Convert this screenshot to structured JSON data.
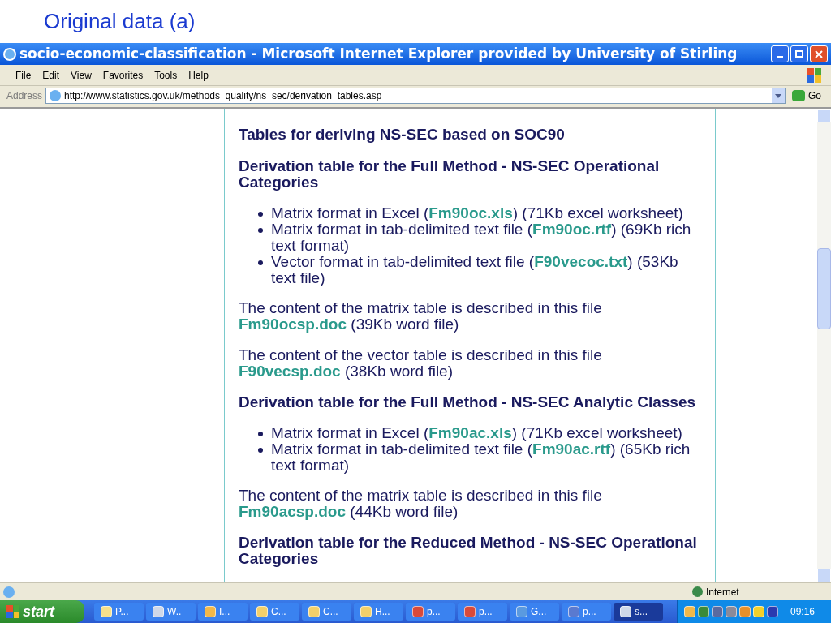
{
  "slide_title": "Original data (a)",
  "window": {
    "title": "socio-economic-classification - Microsoft Internet Explorer provided by University of Stirling"
  },
  "menu": [
    "File",
    "Edit",
    "View",
    "Favorites",
    "Tools",
    "Help"
  ],
  "address": {
    "label": "Address",
    "value": "http://www.statistics.gov.uk/methods_quality/ns_sec/derivation_tables.asp",
    "go": "Go"
  },
  "content": [
    {
      "kind": "title",
      "parts": [
        {
          "text": "Tables for deriving NS-SEC based on SOC90",
          "link": false
        }
      ]
    },
    {
      "kind": "heading",
      "parts": [
        {
          "text": "Derivation table for the Full Method - NS-SEC Operational Categories",
          "link": false
        }
      ]
    },
    {
      "kind": "list",
      "items": [
        [
          {
            "text": "Matrix format in Excel (",
            "link": false
          },
          {
            "text": "Fm90oc.xls",
            "link": true
          },
          {
            "text": ") (71Kb excel worksheet)",
            "link": false
          }
        ],
        [
          {
            "text": "Matrix format in tab-delimited text file (",
            "link": false
          },
          {
            "text": "Fm90oc.rtf",
            "link": true
          },
          {
            "text": ") (69Kb rich text format)",
            "link": false
          }
        ],
        [
          {
            "text": "Vector format in tab-delimited text file (",
            "link": false
          },
          {
            "text": "F90vecoc.txt",
            "link": true
          },
          {
            "text": ") (53Kb text file)",
            "link": false
          }
        ]
      ]
    },
    {
      "kind": "para",
      "parts": [
        {
          "text": "The content of the matrix table is described in this file ",
          "link": false
        },
        {
          "text": "Fm90ocsp.doc",
          "link": true
        },
        {
          "text": " (39Kb word file)",
          "link": false
        }
      ]
    },
    {
      "kind": "para",
      "parts": [
        {
          "text": "The content of the vector table is described in this file ",
          "link": false
        },
        {
          "text": "F90vecsp.doc",
          "link": true
        },
        {
          "text": " (38Kb word file)",
          "link": false
        }
      ]
    },
    {
      "kind": "heading",
      "parts": [
        {
          "text": "Derivation table for the Full Method - NS-SEC Analytic Classes",
          "link": false
        }
      ]
    },
    {
      "kind": "list",
      "items": [
        [
          {
            "text": "Matrix format in Excel (",
            "link": false
          },
          {
            "text": "Fm90ac.xls",
            "link": true
          },
          {
            "text": ") (71Kb excel worksheet)",
            "link": false
          }
        ],
        [
          {
            "text": "Matrix format in tab-delimited text file (",
            "link": false
          },
          {
            "text": "Fm90ac.rtf",
            "link": true
          },
          {
            "text": ") (65Kb rich text format)",
            "link": false
          }
        ]
      ]
    },
    {
      "kind": "para",
      "parts": [
        {
          "text": "The content of the matrix table is described in this file ",
          "link": false
        },
        {
          "text": "Fm90acsp.doc",
          "link": true
        },
        {
          "text": " (44Kb word file)",
          "link": false
        }
      ]
    },
    {
      "kind": "heading",
      "parts": [
        {
          "text": "Derivation table for the Reduced Method - NS-SEC Operational Categories",
          "link": false
        }
      ]
    }
  ],
  "status_bar": {
    "zone": "Internet"
  },
  "taskbar": {
    "start": "start",
    "clock": "09:16",
    "buttons": [
      {
        "label": "P...",
        "selected": false
      },
      {
        "label": "W..",
        "selected": false
      },
      {
        "label": "I...",
        "selected": false
      },
      {
        "label": "C...",
        "selected": false
      },
      {
        "label": "C...",
        "selected": false
      },
      {
        "label": "H...",
        "selected": false
      },
      {
        "label": "p...",
        "selected": false
      },
      {
        "label": "p...",
        "selected": false
      },
      {
        "label": "G...",
        "selected": false
      },
      {
        "label": "p...",
        "selected": false
      },
      {
        "label": "s...",
        "selected": true
      }
    ]
  }
}
